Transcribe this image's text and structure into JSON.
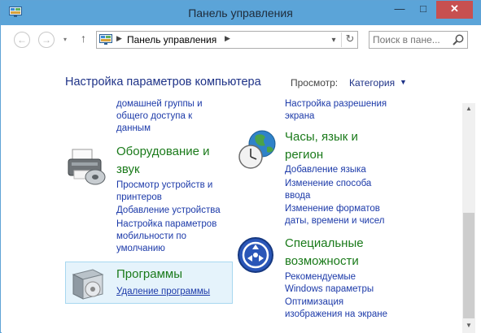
{
  "window": {
    "title": "Панель управления",
    "minimize_glyph": "—",
    "maximize_glyph": "□",
    "close_glyph": "✕"
  },
  "nav": {
    "back_glyph": "←",
    "forward_glyph": "→",
    "recent_glyph": "▾",
    "up_glyph": "↑",
    "breadcrumb_sep": "▶",
    "breadcrumb": "Панель управления",
    "dropdown_glyph": "▾",
    "refresh_glyph": "↻",
    "search_placeholder": "Поиск в пане..."
  },
  "header": {
    "title": "Настройка параметров компьютера",
    "view_label": "Просмотр:",
    "view_value": "Категория",
    "view_arrow": "▼"
  },
  "left_column": {
    "partial_links": [
      "домашней группы и",
      "общего доступа к",
      "данным"
    ],
    "hardware": {
      "title_line1": "Оборудование и",
      "title_line2": "звук",
      "links": [
        "Просмотр устройств и",
        "принтеров",
        "Добавление устройства",
        "Настройка параметров",
        "мобильности по",
        "умолчанию"
      ]
    },
    "programs": {
      "title": "Программы",
      "link": "Удаление программы"
    }
  },
  "right_column": {
    "partial_links": [
      "Настройка разрешения",
      "экрана"
    ],
    "clock": {
      "title_line1": "Часы, язык и",
      "title_line2": "регион",
      "links": [
        "Добавление языка",
        "Изменение способа",
        "ввода",
        "Изменение форматов",
        "даты, времени и чисел"
      ]
    },
    "access": {
      "title_line1": "Специальные",
      "title_line2": "возможности",
      "links": [
        "Рекомендуемые",
        "Windows параметры",
        "Оптимизация",
        "изображения на экране"
      ]
    }
  },
  "scrollbar": {
    "up_glyph": "▲",
    "down_glyph": "▼"
  },
  "icons": {
    "app": "control-panel-icon",
    "hardware": "printer-icon",
    "clock": "globe-clock-icon",
    "programs": "programs-box-icon",
    "access": "ease-of-access-icon"
  },
  "colors": {
    "titlebar": "#5ba4d8",
    "link": "#1c3aa9",
    "category": "#1a7a1a",
    "heading": "#1e3287",
    "close": "#c75050",
    "highlight": "#e5f3fb"
  }
}
